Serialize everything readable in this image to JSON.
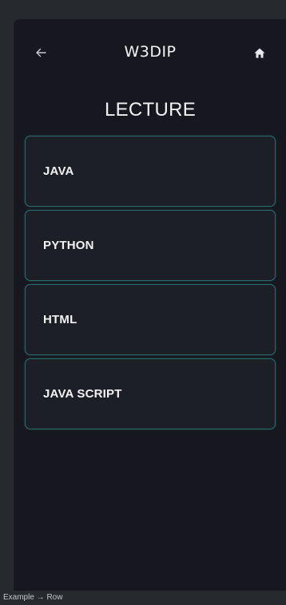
{
  "header": {
    "back_icon": "arrow-left-icon",
    "title": "W3DIP",
    "home_icon": "home-icon"
  },
  "page": {
    "heading": "LECTURE"
  },
  "lectures": [
    {
      "label": "JAVA"
    },
    {
      "label": "PYTHON"
    },
    {
      "label": "HTML"
    },
    {
      "label": "JAVA SCRIPT"
    }
  ],
  "footer": {
    "caption": "Example → Row"
  },
  "colors": {
    "background": "#17181f",
    "card": "#1d1f27",
    "card_border": "#2a6a6e",
    "text": "#f3f3f5"
  }
}
